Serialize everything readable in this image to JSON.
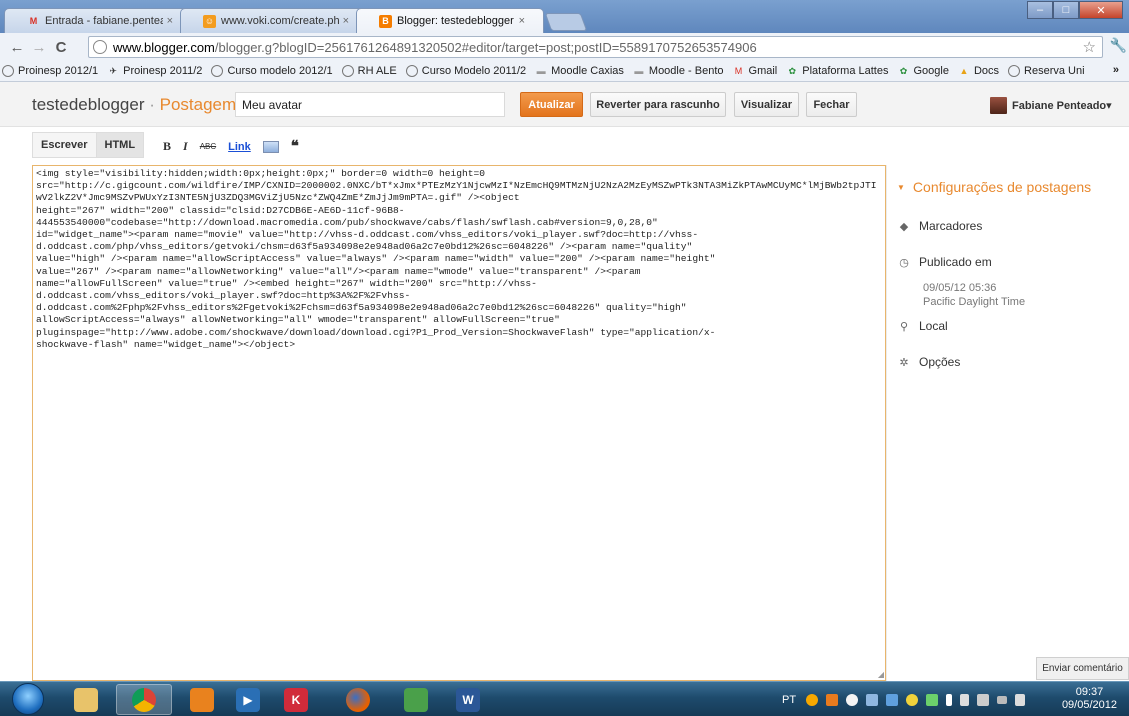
{
  "browser": {
    "tabs": [
      {
        "title": "Entrada - fabiane.penteado",
        "favicon": "gmail-icon",
        "color": "#d93025",
        "active": false
      },
      {
        "title": "www.voki.com/create.php",
        "favicon": "voki-icon",
        "color": "#f39c1f",
        "active": false
      },
      {
        "title": "Blogger: testedeblogger - E",
        "favicon": "blogger-icon",
        "color": "#f57d00",
        "active": true
      }
    ],
    "url": {
      "host": "www.blogger.com",
      "path": "/blogger.g?blogID=2561761264891320502#editor/target=post;postID=5589170752653574906"
    },
    "bookmarks": [
      {
        "label": "Proinesp 2012/1",
        "icon": "globe-icon"
      },
      {
        "label": "Proinesp 2011/2",
        "icon": "bug-icon"
      },
      {
        "label": "Curso modelo 2012/1",
        "icon": "globe-icon"
      },
      {
        "label": "RH ALE",
        "icon": "globe-icon"
      },
      {
        "label": "Curso Modelo 2011/2",
        "icon": "globe-icon"
      },
      {
        "label": "Moodle Caxias",
        "icon": "moodle-icon"
      },
      {
        "label": "Moodle - Bento",
        "icon": "moodle-icon"
      },
      {
        "label": "Gmail",
        "icon": "gmail-icon"
      },
      {
        "label": "Plataforma Lattes",
        "icon": "lattes-icon"
      },
      {
        "label": "Google",
        "icon": "google-icon"
      },
      {
        "label": "Docs",
        "icon": "docs-icon"
      },
      {
        "label": "Reserva Uni",
        "icon": "globe-icon"
      }
    ],
    "bookmarks_more": "»"
  },
  "blogger": {
    "brand_blog": "testedeblogger",
    "brand_sep": "·",
    "brand_section": "Postagem",
    "post_title": "Meu avatar",
    "buttons": {
      "update": "Atualizar",
      "revert": "Reverter para rascunho",
      "preview": "Visualizar",
      "close": "Fechar"
    },
    "user": "Fabiane Penteado▾"
  },
  "toolbar": {
    "compose": "Escrever",
    "html": "HTML",
    "bold": "B",
    "italic": "I",
    "strike": "ABC",
    "link": "Link",
    "quote": "❝"
  },
  "editor": {
    "content": "<img style=\"visibility:hidden;width:0px;height:0px;\" border=0 width=0 height=0\nsrc=\"http://c.gigcount.com/wildfire/IMP/CXNID=2000002.0NXC/bT*xJmx*PTEzMzY1NjcwMzI*NzEmcHQ9MTMzNjU2NzA2MzEyMSZwPTk3NTA3MiZkPTAwMCUyMC*lMjBWb2tpJTIwV2lkZ2V*Jmc9MSZvPWUxYzI3NTE5NjU3ZDQ3MGViZjU5Nzc*ZWQ4ZmE*ZmJjJm9mPTA=.gif\" /><object\nheight=\"267\" width=\"200\" classid=\"clsid:D27CDB6E-AE6D-11cf-96B8-\n444553540000\"codebase=\"http://download.macromedia.com/pub/shockwave/cabs/flash/swflash.cab#version=9,0,28,0\"\nid=\"widget_name\"><param name=\"movie\" value=\"http://vhss-d.oddcast.com/vhss_editors/voki_player.swf?doc=http://vhss-\nd.oddcast.com/php/vhss_editors/getvoki/chsm=d63f5a934098e2e948ad06a2c7e0bd12%26sc=6048226\" /><param name=\"quality\"\nvalue=\"high\" /><param name=\"allowScriptAccess\" value=\"always\" /><param name=\"width\" value=\"200\" /><param name=\"height\"\nvalue=\"267\" /><param name=\"allowNetworking\" value=\"all\"/><param name=\"wmode\" value=\"transparent\" /><param\nname=\"allowFullScreen\" value=\"true\" /><embed height=\"267\" width=\"200\" src=\"http://vhss-\nd.oddcast.com/vhss_editors/voki_player.swf?doc=http%3A%2F%2Fvhss-\nd.oddcast.com%2Fphp%2Fvhss_editors%2Fgetvoki%2Fchsm=d63f5a934098e2e948ad06a2c7e0bd12%26sc=6048226\" quality=\"high\"\nallowScriptAccess=\"always\" allowNetworking=\"all\" wmode=\"transparent\" allowFullScreen=\"true\"\npluginspage=\"http://www.adobe.com/shockwave/download/download.cgi?P1_Prod_Version=ShockwaveFlash\" type=\"application/x-\nshockwave-flash\" name=\"widget_name\"></object>"
  },
  "sidebar": {
    "header": "Configurações de postagens",
    "labels": "Marcadores",
    "published": "Publicado em",
    "published_date": "09/05/12 05:36",
    "published_tz": "Pacific Daylight Time",
    "location": "Local",
    "options": "Opções"
  },
  "send_comment": "Enviar comentário",
  "taskbar": {
    "language": "PT",
    "time": "09:37",
    "date": "09/05/2012"
  },
  "colors": {
    "accent_orange": "#e8892f",
    "editor_border": "#e8b56c",
    "link_blue": "#1a4fd6"
  }
}
